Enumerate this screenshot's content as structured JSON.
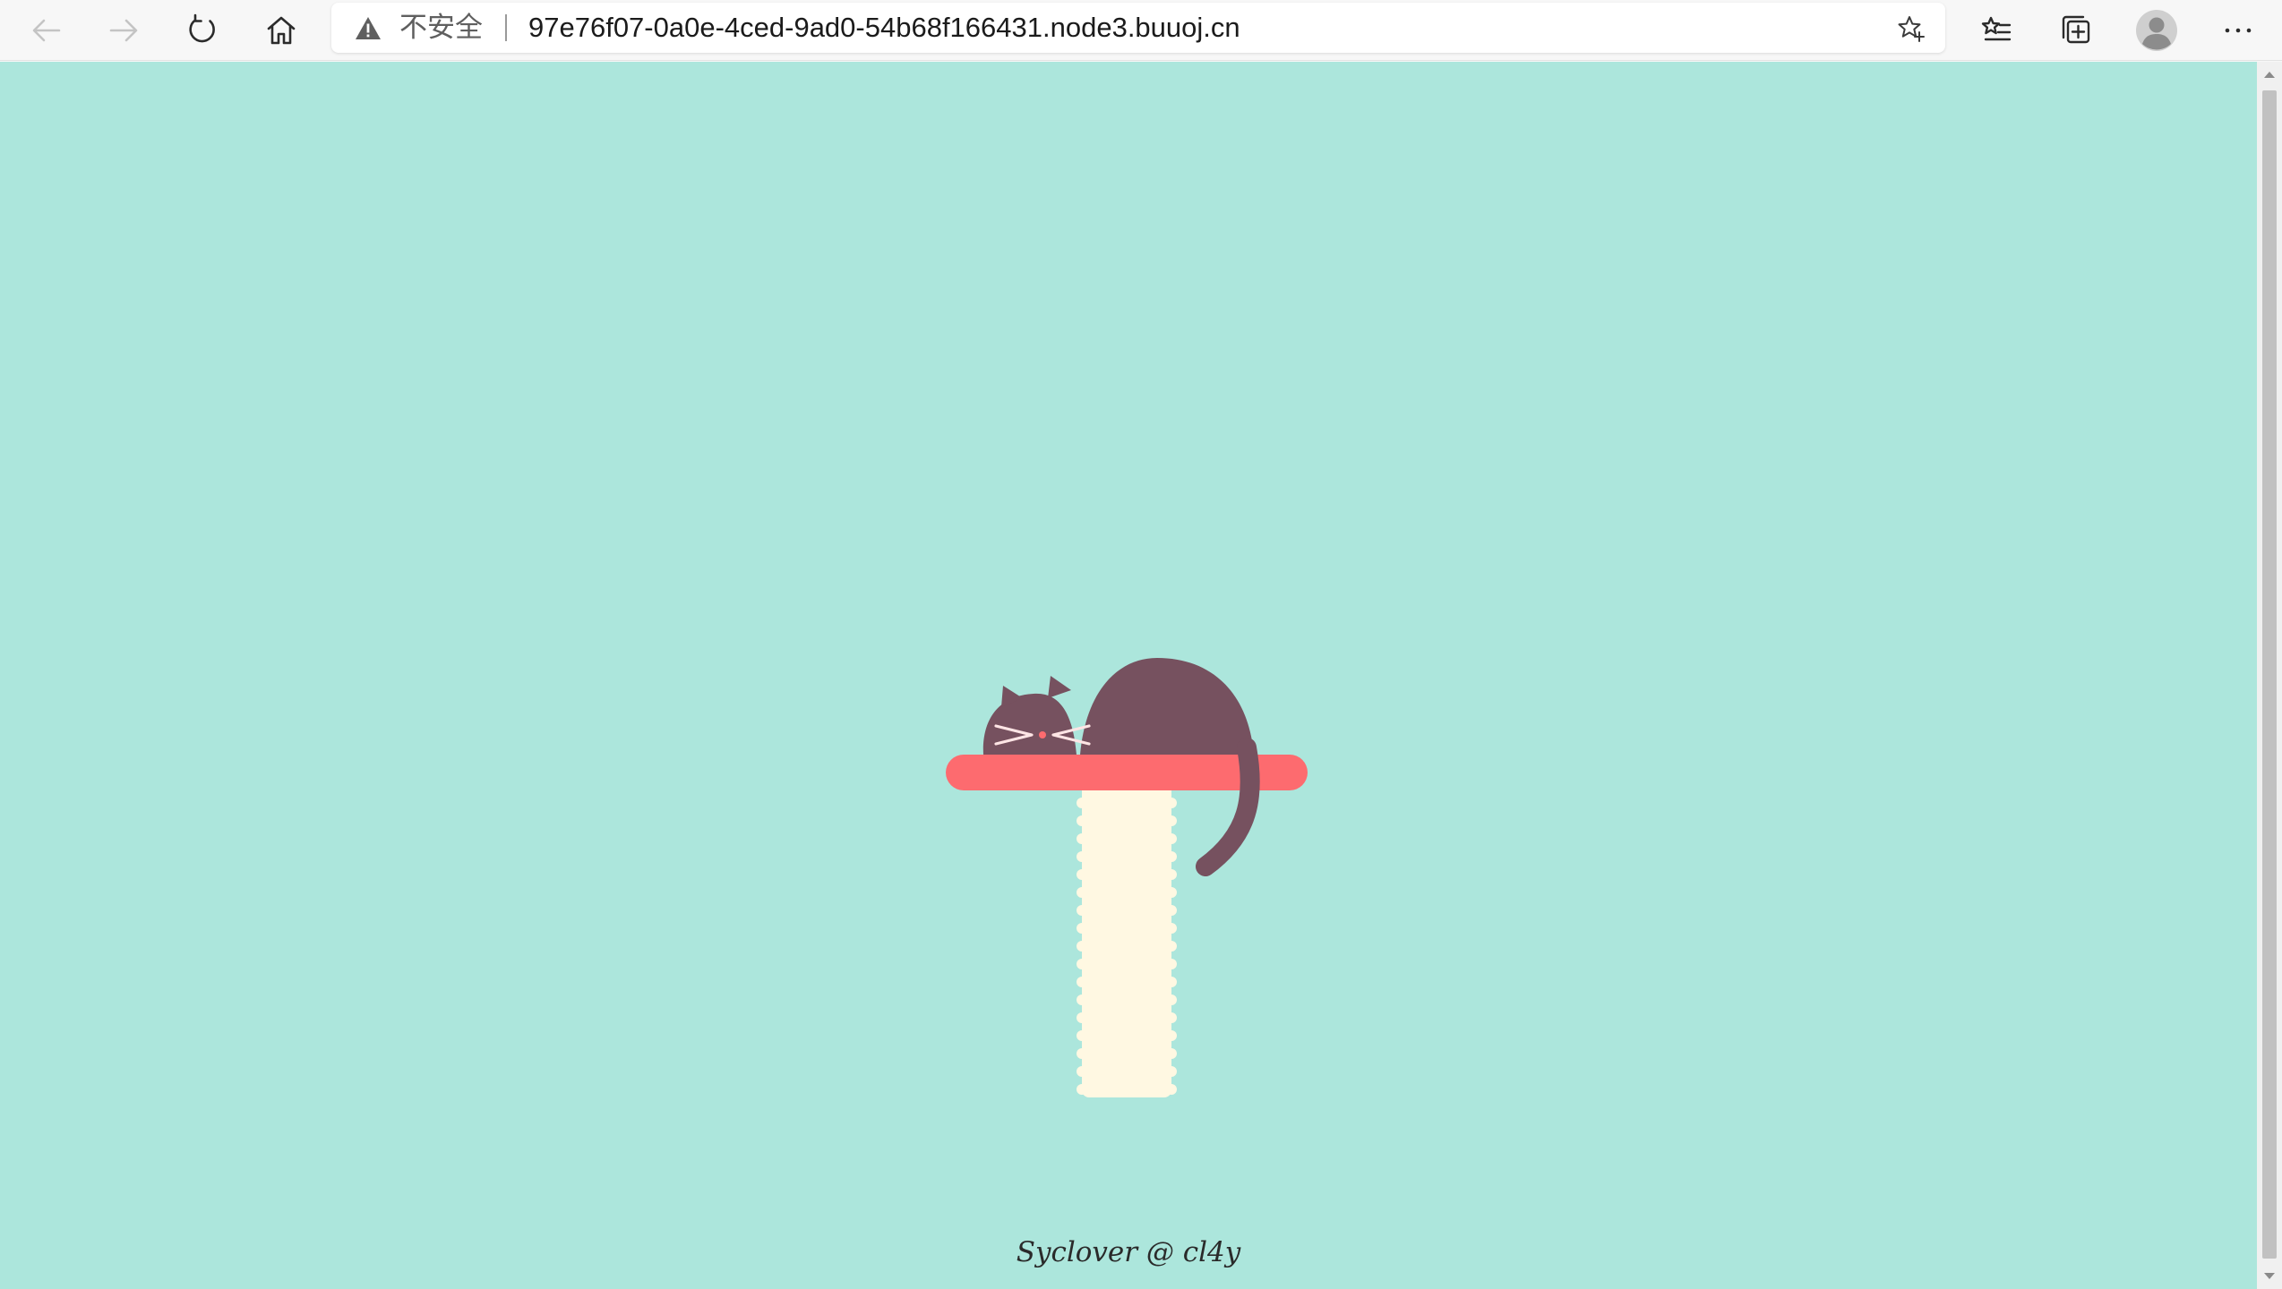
{
  "browser": {
    "security_label": "不安全",
    "url": "97e76f07-0a0e-4ced-9ad0-54b68f166431.node3.buuoj.cn",
    "icons": {
      "back": "arrow-left-icon",
      "forward": "arrow-right-icon",
      "reload": "refresh-icon",
      "home": "home-icon",
      "warning": "warning-triangle-icon",
      "favorite": "star-add-icon",
      "favorites_list": "favorites-list-icon",
      "collections": "collections-icon",
      "profile": "profile-avatar-icon",
      "menu": "more-dots-icon"
    }
  },
  "page": {
    "background_color": "#ace6dc",
    "footer_text": "Syclover @ cl4y",
    "illustration": {
      "subject": "sleeping cat on scratching post",
      "cat_color": "#76515f",
      "shelf_color": "#fd6b6f",
      "post_color": "#fff8e2",
      "face_marks_color": "#ffe5e5",
      "nose_color": "#fd6b6f"
    }
  }
}
